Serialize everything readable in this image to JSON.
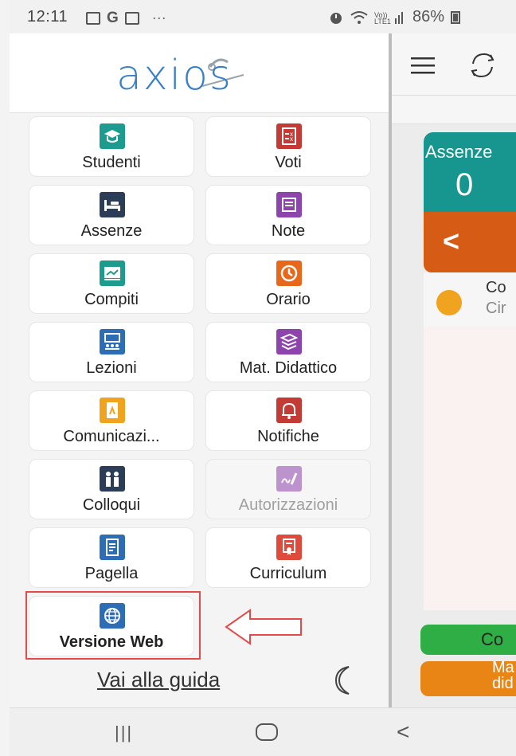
{
  "status_bar": {
    "time": "12:11",
    "extra": "···",
    "battery": "86%"
  },
  "drawer": {
    "logo_text": "axios",
    "tiles": [
      {
        "label": "Studenti",
        "icon": "graduation-cap-icon",
        "color": "#1e9b8f"
      },
      {
        "label": "Voti",
        "icon": "grade-list-icon",
        "color": "#c43a35"
      },
      {
        "label": "Assenze",
        "icon": "bed-icon",
        "color": "#2c3e57"
      },
      {
        "label": "Note",
        "icon": "note-icon",
        "color": "#8e44ad"
      },
      {
        "label": "Compiti",
        "icon": "board-icon",
        "color": "#1e9b8f"
      },
      {
        "label": "Orario",
        "icon": "clock-icon",
        "color": "#e8671b"
      },
      {
        "label": "Lezioni",
        "icon": "classroom-icon",
        "color": "#2d6db5"
      },
      {
        "label": "Mat. Didattico",
        "icon": "books-icon",
        "color": "#8e44ad"
      },
      {
        "label": "Comunicazi...",
        "icon": "pdf-file-icon",
        "color": "#f0a31e"
      },
      {
        "label": "Notifiche",
        "icon": "bell-icon",
        "color": "#c43a35"
      },
      {
        "label": "Colloqui",
        "icon": "people-icon",
        "color": "#2c3e57"
      },
      {
        "label": "Autorizzazioni",
        "icon": "signature-icon",
        "color": "#8e44ad"
      },
      {
        "label": "Pagella",
        "icon": "report-card-icon",
        "color": "#2d6db5"
      },
      {
        "label": "Curriculum",
        "icon": "certificate-icon",
        "color": "#e04a3a"
      },
      {
        "label": "Versione Web",
        "icon": "globe-icon",
        "color": "#2d6db5"
      }
    ],
    "guide_link": "Vai alla guida"
  },
  "right_pane": {
    "card_title": "Assenze",
    "card_value": "0",
    "back_chevron": "<",
    "event_title": "Co",
    "event_subtitle": "Cir",
    "green_button": "Co",
    "orange_button": "Ma did"
  },
  "nav": {
    "recent": "|||",
    "back": "<"
  }
}
